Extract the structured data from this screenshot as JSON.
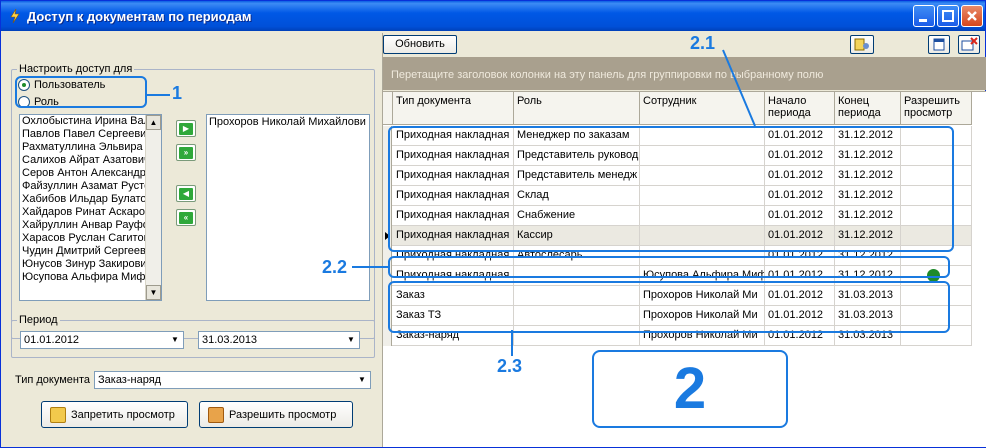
{
  "window": {
    "title": "Доступ к документам по периодам"
  },
  "access": {
    "legend": "Настроить доступ для",
    "radio_user": "Пользователь",
    "radio_role": "Роль",
    "users": [
      "Охлобыстина Ирина Вале",
      "Павлов Павел Сергееви",
      "Рахматуллина Эльвира Д",
      "Салихов Айрат Азатович",
      "Серов Антон Александро",
      "Файзуллин Азамат Русте",
      "Хабибов Ильдар Булатов",
      "Хайдаров Ринат Аскаров",
      "Хайруллин Анвар Рауфов",
      "Харасов  Руслан  Сагитов",
      "Чудин Дмитрий Сергееви",
      "Юнусов Зинур Закирович",
      "Юсупова Альфира Мифта"
    ],
    "selected": [
      "Прохоров Николай Михайлови"
    ],
    "btn_add": "▶",
    "btn_add_all": "»",
    "btn_remove": "◀",
    "btn_remove_all": "«"
  },
  "period": {
    "legend": "Период",
    "from": "01.01.2012",
    "to": "31.03.2013"
  },
  "doc_type": {
    "label": "Тип документа",
    "value": "Заказ-наряд"
  },
  "actions": {
    "deny": "Запретить просмотр",
    "allow": "Разрешить просмотр"
  },
  "toolbar": {
    "refresh": "Обновить"
  },
  "grid": {
    "group_hint": "Перетащите заголовок колонки на эту панель для группировки по выбранному полю",
    "columns": [
      "Тип документа",
      "Роль",
      "Сотрудник",
      "Начало периода",
      "Конец периода",
      "Разрешить просмотр"
    ],
    "rows": [
      [
        "Приходная накладная",
        "Менеджер по заказам",
        "",
        "01.01.2012",
        "31.12.2012",
        ""
      ],
      [
        "Приходная накладная",
        "Представитель руковод",
        "",
        "01.01.2012",
        "31.12.2012",
        ""
      ],
      [
        "Приходная накладная",
        "Представитель менедж",
        "",
        "01.01.2012",
        "31.12.2012",
        ""
      ],
      [
        "Приходная накладная",
        "Склад",
        "",
        "01.01.2012",
        "31.12.2012",
        ""
      ],
      [
        "Приходная накладная",
        "Снабжение",
        "",
        "01.01.2012",
        "31.12.2012",
        ""
      ],
      [
        "Приходная накладная",
        "Кассир",
        "",
        "01.01.2012",
        "31.12.2012",
        ""
      ],
      [
        "Приходная накладная",
        "Автослесарь",
        "",
        "01.01.2012",
        "31.12.2012",
        ""
      ],
      [
        "Приходная накладная",
        "",
        "Юсупова Альфира Миф",
        "01.01.2012",
        "31.12.2012",
        ""
      ],
      [
        "Заказ",
        "",
        "Прохоров Николай Ми",
        "01.01.2012",
        "31.03.2013",
        ""
      ],
      [
        "Заказ ТЗ",
        "",
        "Прохоров Николай Ми",
        "01.01.2012",
        "31.03.2013",
        ""
      ],
      [
        "Заказ-наряд",
        "",
        "Прохоров Николай Ми",
        "01.01.2012",
        "31.03.2013",
        ""
      ]
    ],
    "selected_row": 5,
    "allowed_row": 7,
    "allowed_color": "#1e8a2a"
  },
  "annotations": {
    "a1": "1",
    "a2": "2",
    "a21": "2.1",
    "a22": "2.2",
    "a23": "2.3",
    "accent": "#1a7ae0"
  }
}
